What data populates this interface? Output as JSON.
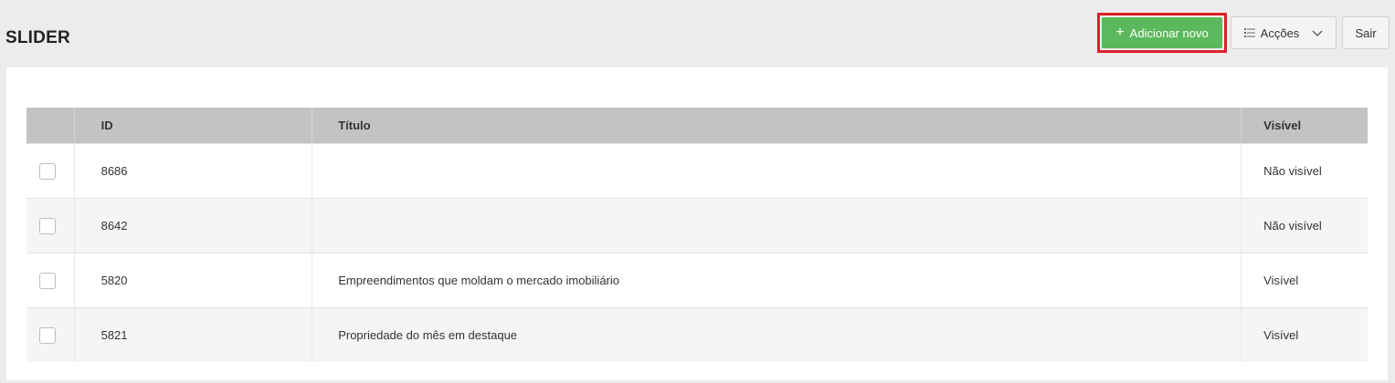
{
  "header": {
    "title": "SLIDER",
    "add_button": {
      "label": "Adicionar novo",
      "icon": "plus-icon"
    },
    "actions_button": {
      "label": "Acções",
      "icon": "list-icon",
      "chevron": "chevron-down-icon"
    },
    "exit_button": {
      "label": "Sair"
    }
  },
  "table": {
    "columns": [
      "",
      "ID",
      "Título",
      "Visível"
    ],
    "rows": [
      {
        "id": "8686",
        "title": "",
        "visible": "Não visível"
      },
      {
        "id": "8642",
        "title": "",
        "visible": "Não visível"
      },
      {
        "id": "5820",
        "title": "Empreendimentos que moldam o mercado imobiliário",
        "visible": "Visível"
      },
      {
        "id": "5821",
        "title": "Propriedade do mês em destaque",
        "visible": "Visível"
      }
    ]
  },
  "colors": {
    "add_button_bg": "#5cb85c",
    "highlight_border": "#e0202a",
    "header_row_bg": "#c3c3c3",
    "page_bg": "#ececec"
  }
}
